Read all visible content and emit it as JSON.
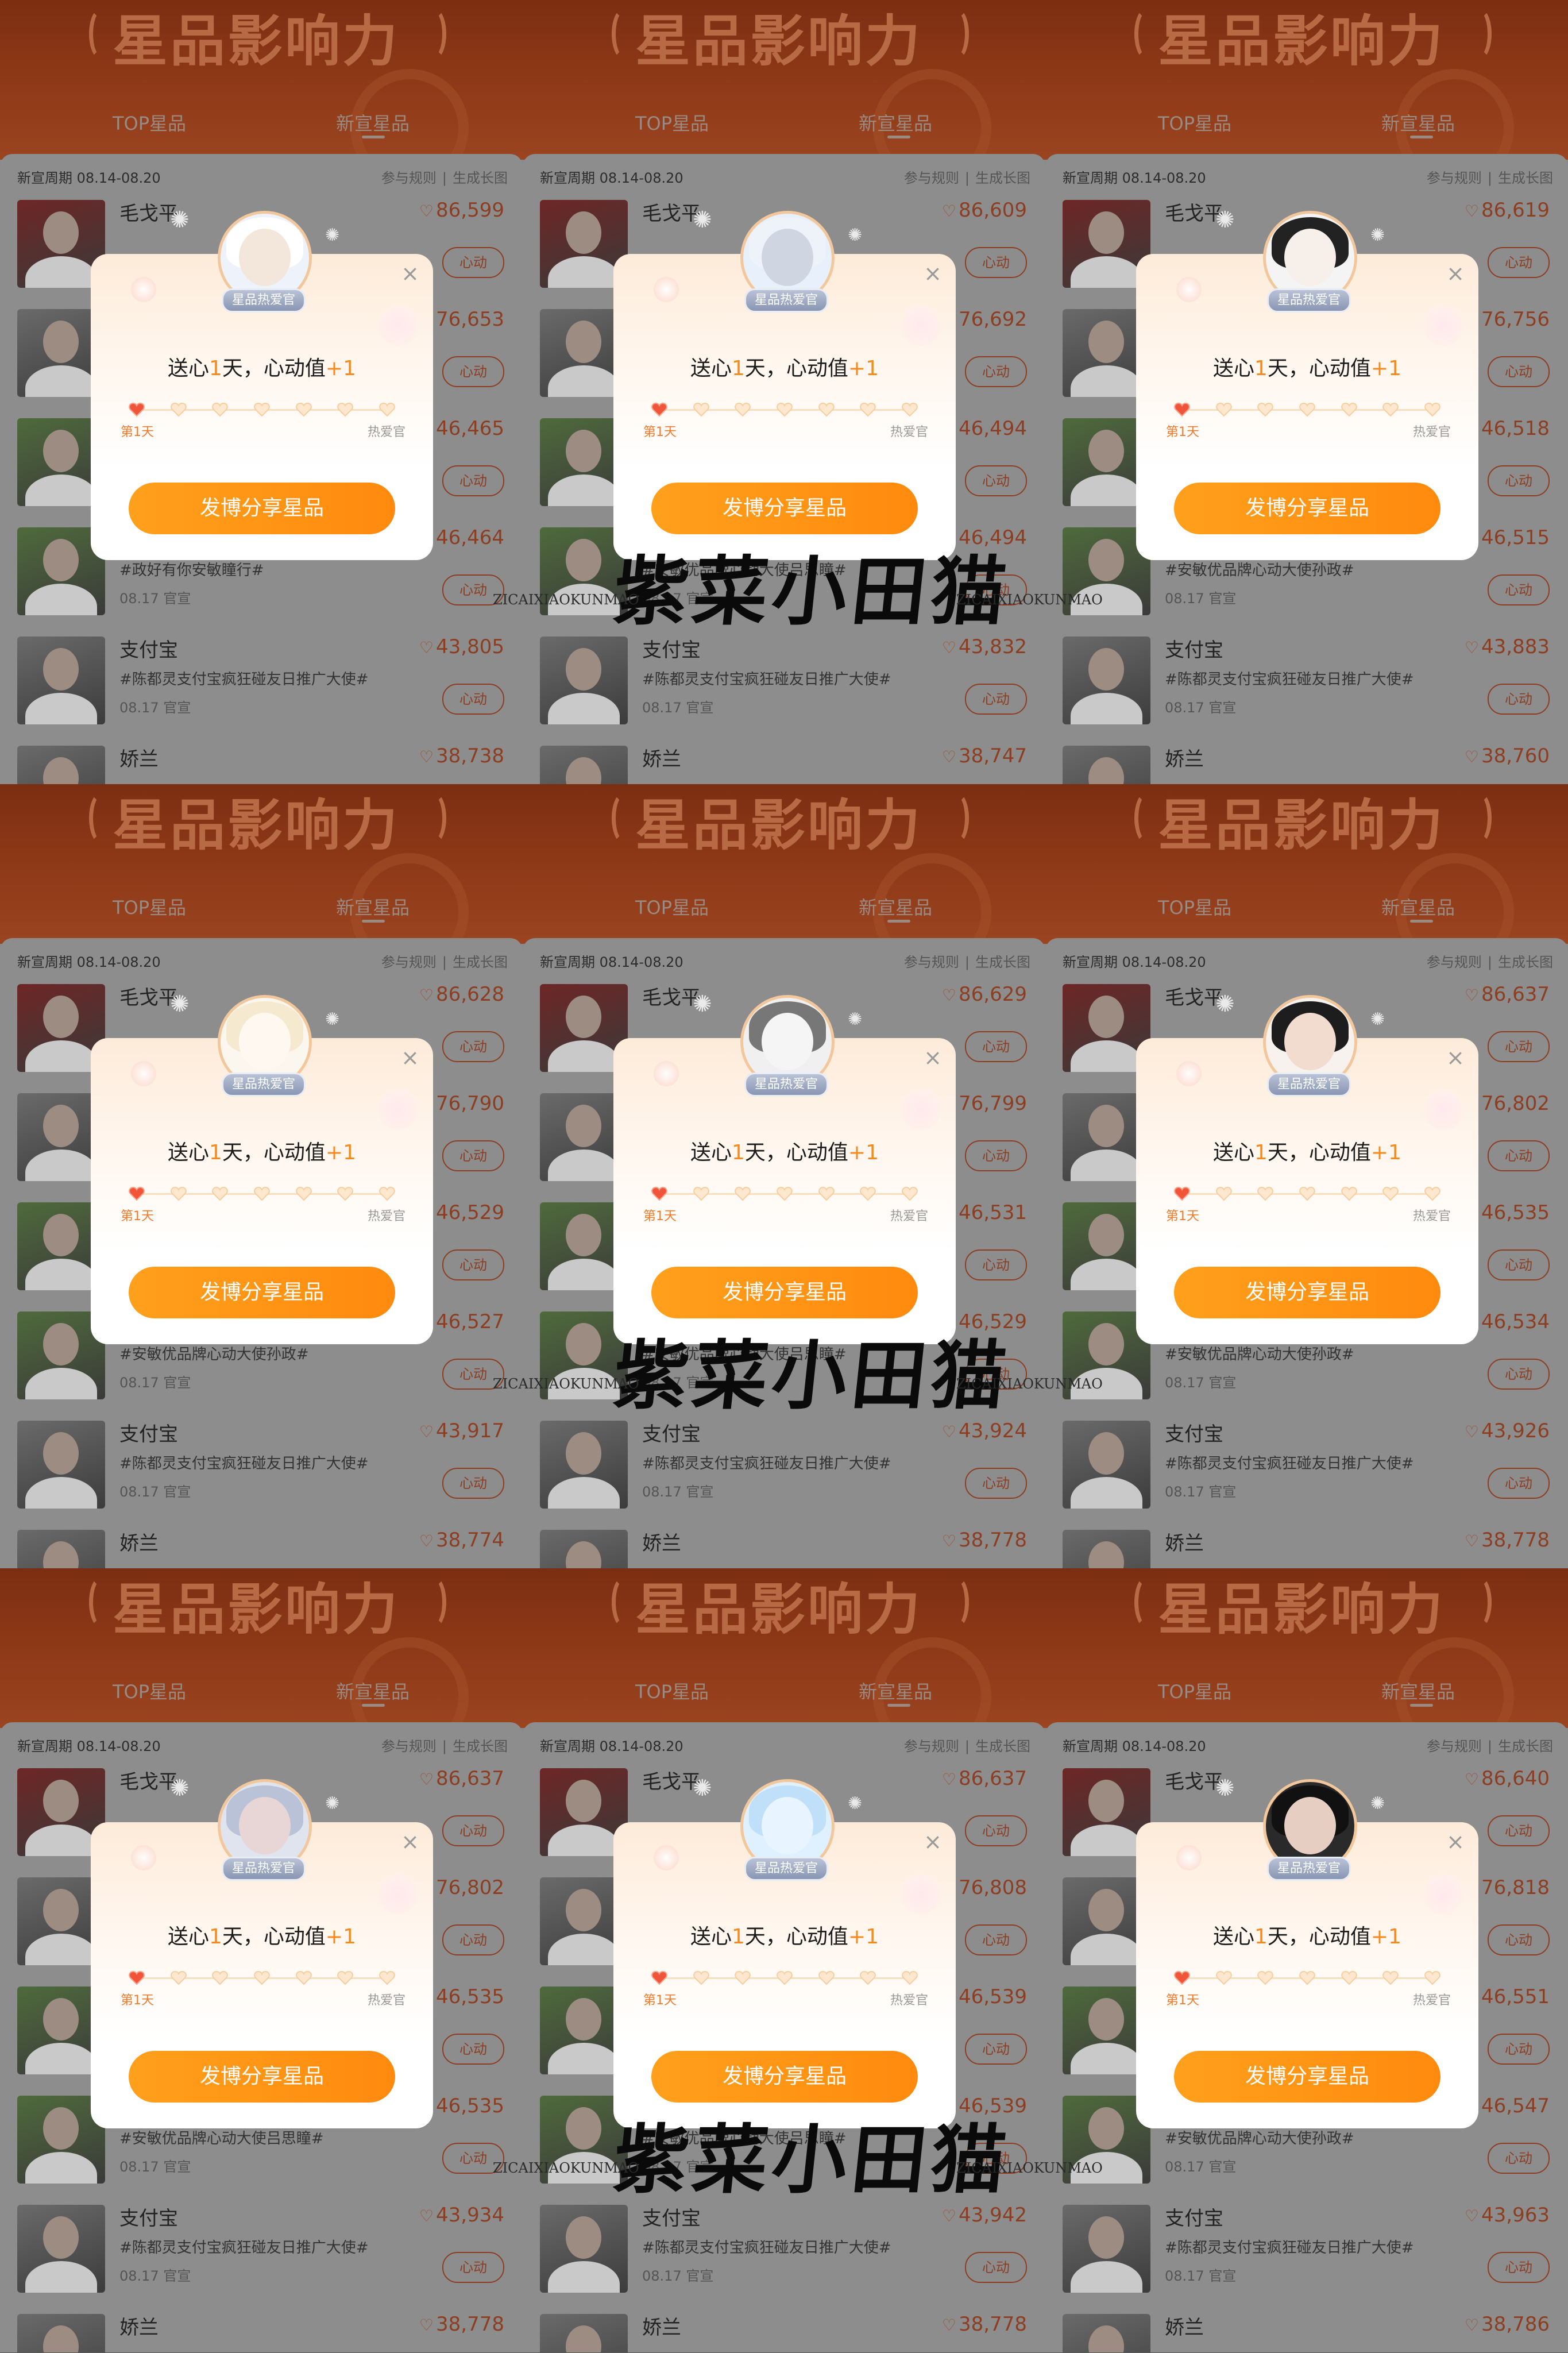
{
  "banner": {
    "title": "星品影响力",
    "tab_top": "TOP星品",
    "tab_new": "新宣星品"
  },
  "list_header": {
    "period": "新宣周期 08.14-08.20",
    "rules": "参与规则",
    "sep": "|",
    "long_image": "生成长图"
  },
  "modal": {
    "badge": "星品热爱官",
    "title_prefix": "送心",
    "title_days": "1",
    "title_mid": "天，心动值",
    "title_plus": "+1",
    "progress_days": 7,
    "progress_filled": 1,
    "progress_start": "第1天",
    "progress_end": "热爱官",
    "share_button": "发博分享星品",
    "close": "×"
  },
  "heart_button": "心动",
  "brands": {
    "b1": "毛戈平",
    "b4": "安敏优",
    "b5": "支付宝",
    "b6": "娇兰",
    "b5_tag": "#陈都灵支付宝疯狂碰友日推广大使#",
    "date": "08.17 官宣"
  },
  "watermark": {
    "cn": "紫菜小田猫",
    "en": "ZICAIXIAOKUNMAO"
  },
  "panels": [
    {
      "scores": [
        "86,599",
        "76,653",
        "46,465",
        "46,464",
        "43,805",
        "38,738"
      ],
      "tag4": "#政好有你安敏瞳行#",
      "date4": "08.17 官宣",
      "avatar": "glasses"
    },
    {
      "scores": [
        "86,609",
        "76,692",
        "46,494",
        "46,494",
        "43,832",
        "38,747"
      ],
      "tag4": "#安敏优品牌心动大使吕思瞳#",
      "date4": "08.17 官宣",
      "avatar": "bunny"
    },
    {
      "scores": [
        "86,619",
        "76,756",
        "46,518",
        "46,515",
        "43,883",
        "38,760"
      ],
      "tag4": "#安敏优品牌心动大使孙政#",
      "date4": "08.17 官宣",
      "avatar": "darkhair"
    },
    {
      "scores": [
        "86,628",
        "76,790",
        "46,529",
        "46,527",
        "43,917",
        "38,774"
      ],
      "tag4": "#安敏优品牌心动大使孙政#",
      "date4": "08.17 官宣",
      "avatar": "blonde"
    },
    {
      "scores": [
        "86,629",
        "76,799",
        "46,531",
        "46,529",
        "43,924",
        "38,778"
      ],
      "tag4": "#安敏优品牌心动大使吕思瞳#",
      "date4": "08.17 官宣",
      "avatar": "sketch"
    },
    {
      "scores": [
        "86,637",
        "76,802",
        "46,535",
        "46,534",
        "43,926",
        "38,778"
      ],
      "tag4": "#安敏优品牌心动大使孙政#",
      "date4": "08.17 官宣",
      "avatar": "longblack"
    },
    {
      "scores": [
        "86,637",
        "76,802",
        "46,535",
        "46,535",
        "43,934",
        "38,778"
      ],
      "tag4": "#安敏优品牌心动大使吕思瞳#",
      "date4": "08.17 官宣",
      "avatar": "silver"
    },
    {
      "scores": [
        "86,637",
        "76,808",
        "46,539",
        "46,539",
        "43,942",
        "38,778"
      ],
      "tag4": "#安敏优品牌心动大使吕思瞳#",
      "date4": "08.17 官宣",
      "avatar": "ice"
    },
    {
      "scores": [
        "86,640",
        "76,818",
        "46,551",
        "46,547",
        "43,963",
        "38,786"
      ],
      "tag4": "#安敏优品牌心动大使孙政#",
      "date4": "08.17 官宣",
      "avatar": "portrait"
    }
  ],
  "colors": {
    "accent_orange": "#ff8a0e",
    "score_overlay": "#8c3e22",
    "modal_bg": "#fff6ee"
  }
}
